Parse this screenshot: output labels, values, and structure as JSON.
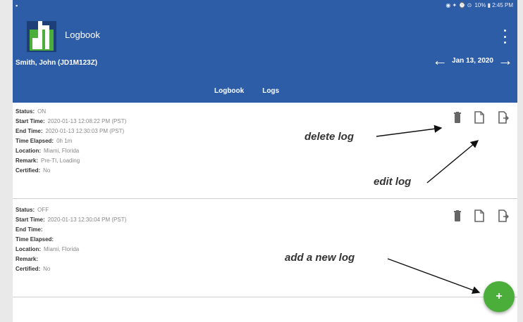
{
  "colors": {
    "appbar": "#2e5da8",
    "fab": "#4cae3a",
    "logo_green": "#4cae3a",
    "logo_navy": "#1e3e78"
  },
  "status_bar": {
    "left_text": "▪",
    "right_text": "10% ▮ 2:45 PM"
  },
  "app": {
    "title": "Logbook",
    "driver": "Smith, John (JD1M123Z)",
    "date": "Jan 13, 2020"
  },
  "tabs": [
    {
      "label": "Logbook",
      "active": false
    },
    {
      "label": "Logs",
      "active": true
    }
  ],
  "logs": [
    {
      "status": [
        "Status:",
        "ON"
      ],
      "start": [
        "Start Time:",
        "2020-01-13 12:08:22 PM (PST)"
      ],
      "end": [
        "End Time:",
        "2020-01-13 12:30:03 PM (PST)"
      ],
      "elapsed": [
        "Time Elapsed:",
        "0h 1m"
      ],
      "location": [
        "Location:",
        "Miami, Florida"
      ],
      "remark": [
        "Remark:",
        "Pre-TI, Loading"
      ],
      "certified": [
        "Certified:",
        "No"
      ]
    },
    {
      "status": [
        "Status:",
        "OFF"
      ],
      "start": [
        "Start Time:",
        "2020-01-13 12:30:04 PM (PST)"
      ],
      "end": [
        "End Time:",
        ""
      ],
      "elapsed": [
        "Time Elapsed:",
        ""
      ],
      "location": [
        "Location:",
        "Miami, Florida"
      ],
      "remark": [
        "Remark:",
        ""
      ],
      "certified": [
        "Certified:",
        "No"
      ]
    }
  ],
  "annotations": {
    "delete": "delete log",
    "edit": "edit log",
    "add": "add a new log"
  },
  "fab": {
    "label": "+"
  },
  "icons": {
    "delete": "trash-icon",
    "edit": "edit-icon",
    "export": "export-icon",
    "add": "plus-icon"
  }
}
